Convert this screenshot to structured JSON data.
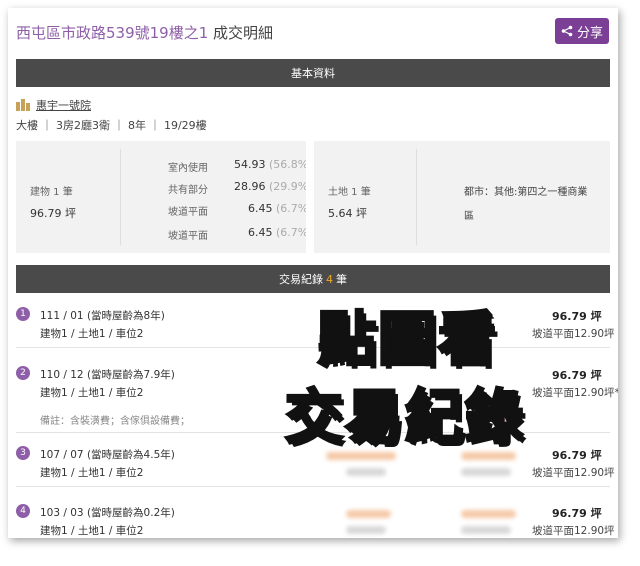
{
  "header": {
    "address": "西屯區市政路539號19樓之1",
    "suffix": " 成交明細",
    "share_label": "分享"
  },
  "basic": {
    "section_title": "基本資料",
    "community_name": "惠宇一號院",
    "specs": "大樓 ｜ 3房2廳3衛 ｜ 8年 ｜ 19/29樓"
  },
  "summary": {
    "building_label": "建物 1 筆",
    "building_value": "96.79 坪",
    "rows": [
      {
        "label": "室內使用",
        "value": "54.93",
        "pct": "(56.8%)"
      },
      {
        "label": "共有部分",
        "value": "28.96",
        "pct": "(29.9%)"
      },
      {
        "label": "坡道平面",
        "value": "6.45",
        "pct": "(6.7%)"
      },
      {
        "label": "坡道平面",
        "value": "6.45",
        "pct": "(6.7%)"
      }
    ],
    "land_label": "土地 1 筆",
    "land_value": "5.64 坪",
    "zoning_line1": "都市：其他:第四之一種商業",
    "zoning_line2": "區"
  },
  "transactions": {
    "section_prefix": "交易紀錄",
    "count": "4",
    "section_suffix": "筆",
    "items": [
      {
        "index": "1",
        "date": "111 / 01 (當時屋齡為8年)",
        "detail": "建物1 / 土地1 / 車位2",
        "note": "",
        "area": "96.79 坪",
        "ramp": "坡道平面12.90坪"
      },
      {
        "index": "2",
        "date": "110 / 12 (當時屋齡為7.9年)",
        "detail": "建物1 / 土地1 / 車位2",
        "note": "備註：含裝潢費；含傢俱設備費；",
        "area": "96.79 坪",
        "ramp": "坡道平面12.90坪*"
      },
      {
        "index": "3",
        "date": "107 / 07 (當時屋齡為4.5年)",
        "detail": "建物1 / 土地1 / 車位2",
        "note": "",
        "area": "96.79 坪",
        "ramp": "坡道平面12.90坪"
      },
      {
        "index": "4",
        "date": "103 / 03 (當時屋齡為0.2年)",
        "detail": "建物1 / 土地1 / 車位2",
        "note": "",
        "area": "96.79 坪",
        "ramp": "坡道平面12.90坪"
      }
    ]
  },
  "overlay": {
    "line1": "點圖看",
    "line2": "交易紀錄"
  },
  "colors": {
    "accent_purple": "#7b3f95",
    "count_orange": "#f5a623",
    "overlay_yellow": "#ffe833",
    "overlay_pink": "#f4a6d8"
  }
}
